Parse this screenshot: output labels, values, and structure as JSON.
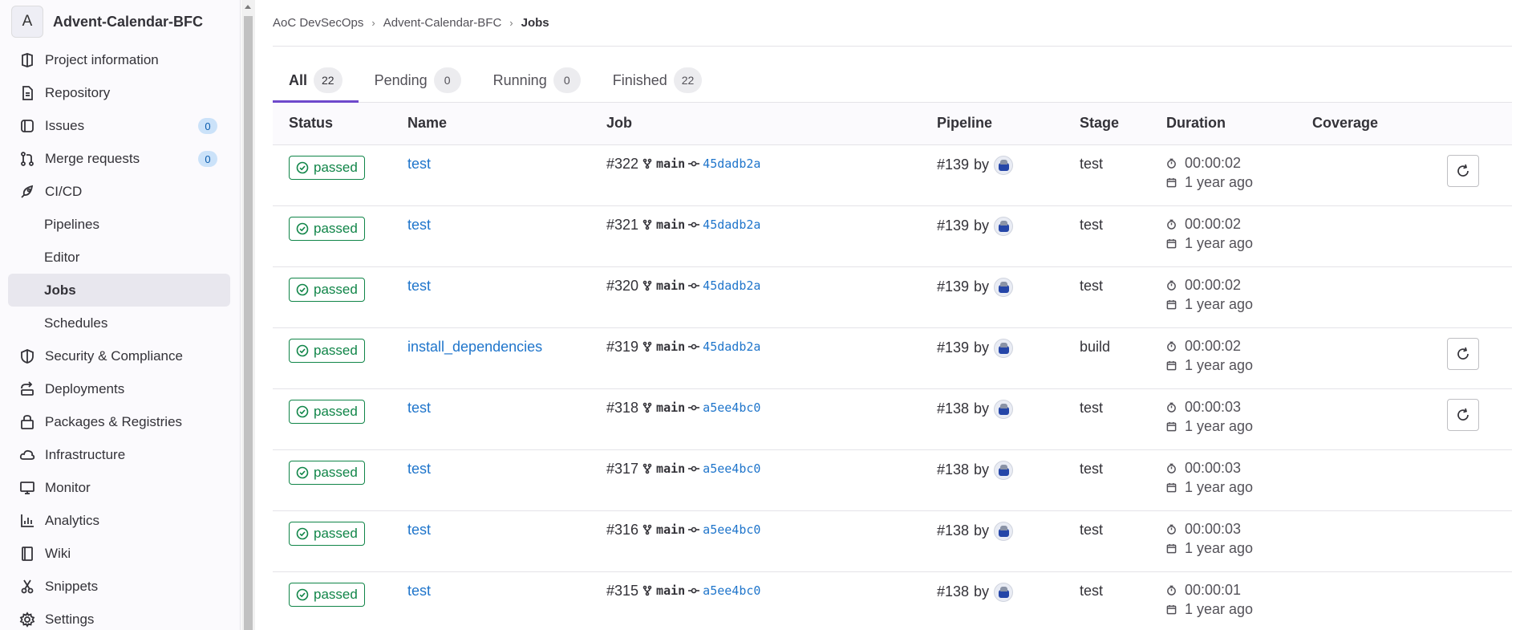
{
  "project": {
    "avatar_letter": "A",
    "name": "Advent-Calendar-BFC"
  },
  "sidebar": {
    "items": [
      {
        "label": "Project information",
        "icon": "info-icon"
      },
      {
        "label": "Repository",
        "icon": "doc-icon"
      },
      {
        "label": "Issues",
        "icon": "issues-icon",
        "count": "0"
      },
      {
        "label": "Merge requests",
        "icon": "merge-request-icon",
        "count": "0"
      },
      {
        "label": "CI/CD",
        "icon": "rocket-icon"
      },
      {
        "label": "Security & Compliance",
        "icon": "shield-icon"
      },
      {
        "label": "Deployments",
        "icon": "deployments-icon"
      },
      {
        "label": "Packages & Registries",
        "icon": "package-icon"
      },
      {
        "label": "Infrastructure",
        "icon": "cloud-icon"
      },
      {
        "label": "Monitor",
        "icon": "monitor-icon"
      },
      {
        "label": "Analytics",
        "icon": "chart-icon"
      },
      {
        "label": "Wiki",
        "icon": "book-icon"
      },
      {
        "label": "Snippets",
        "icon": "scissors-icon"
      },
      {
        "label": "Settings",
        "icon": "settings-icon"
      }
    ],
    "cicd_sub": [
      "Pipelines",
      "Editor",
      "Jobs",
      "Schedules"
    ]
  },
  "breadcrumb": [
    "AoC DevSecOps",
    "Advent-Calendar-BFC",
    "Jobs"
  ],
  "tabs": [
    {
      "label": "All",
      "count": "22"
    },
    {
      "label": "Pending",
      "count": "0"
    },
    {
      "label": "Running",
      "count": "0"
    },
    {
      "label": "Finished",
      "count": "22"
    }
  ],
  "table": {
    "headers": [
      "Status",
      "Name",
      "Job",
      "Pipeline",
      "Stage",
      "Duration",
      "Coverage"
    ],
    "pipeline_by": "by",
    "rows": [
      {
        "status": "passed",
        "name": "test",
        "job": "#322",
        "branch": "main",
        "sha": "45dadb2a",
        "pipeline": "#139",
        "stage": "test",
        "duration": "00:00:02",
        "finished": "1 year ago",
        "retry": true
      },
      {
        "status": "passed",
        "name": "test",
        "job": "#321",
        "branch": "main",
        "sha": "45dadb2a",
        "pipeline": "#139",
        "stage": "test",
        "duration": "00:00:02",
        "finished": "1 year ago",
        "retry": false
      },
      {
        "status": "passed",
        "name": "test",
        "job": "#320",
        "branch": "main",
        "sha": "45dadb2a",
        "pipeline": "#139",
        "stage": "test",
        "duration": "00:00:02",
        "finished": "1 year ago",
        "retry": false
      },
      {
        "status": "passed",
        "name": "install_dependencies",
        "job": "#319",
        "branch": "main",
        "sha": "45dadb2a",
        "pipeline": "#139",
        "stage": "build",
        "duration": "00:00:02",
        "finished": "1 year ago",
        "retry": true
      },
      {
        "status": "passed",
        "name": "test",
        "job": "#318",
        "branch": "main",
        "sha": "a5ee4bc0",
        "pipeline": "#138",
        "stage": "test",
        "duration": "00:00:03",
        "finished": "1 year ago",
        "retry": true
      },
      {
        "status": "passed",
        "name": "test",
        "job": "#317",
        "branch": "main",
        "sha": "a5ee4bc0",
        "pipeline": "#138",
        "stage": "test",
        "duration": "00:00:03",
        "finished": "1 year ago",
        "retry": false
      },
      {
        "status": "passed",
        "name": "test",
        "job": "#316",
        "branch": "main",
        "sha": "a5ee4bc0",
        "pipeline": "#138",
        "stage": "test",
        "duration": "00:00:03",
        "finished": "1 year ago",
        "retry": false
      },
      {
        "status": "passed",
        "name": "test",
        "job": "#315",
        "branch": "main",
        "sha": "a5ee4bc0",
        "pipeline": "#138",
        "stage": "test",
        "duration": "00:00:01",
        "finished": "1 year ago",
        "retry": false
      }
    ]
  },
  "colors": {
    "passed": "#108548",
    "link": "#1f75cb",
    "active_tab": "#6e49cb",
    "badge_bg": "#cbe2f9"
  }
}
